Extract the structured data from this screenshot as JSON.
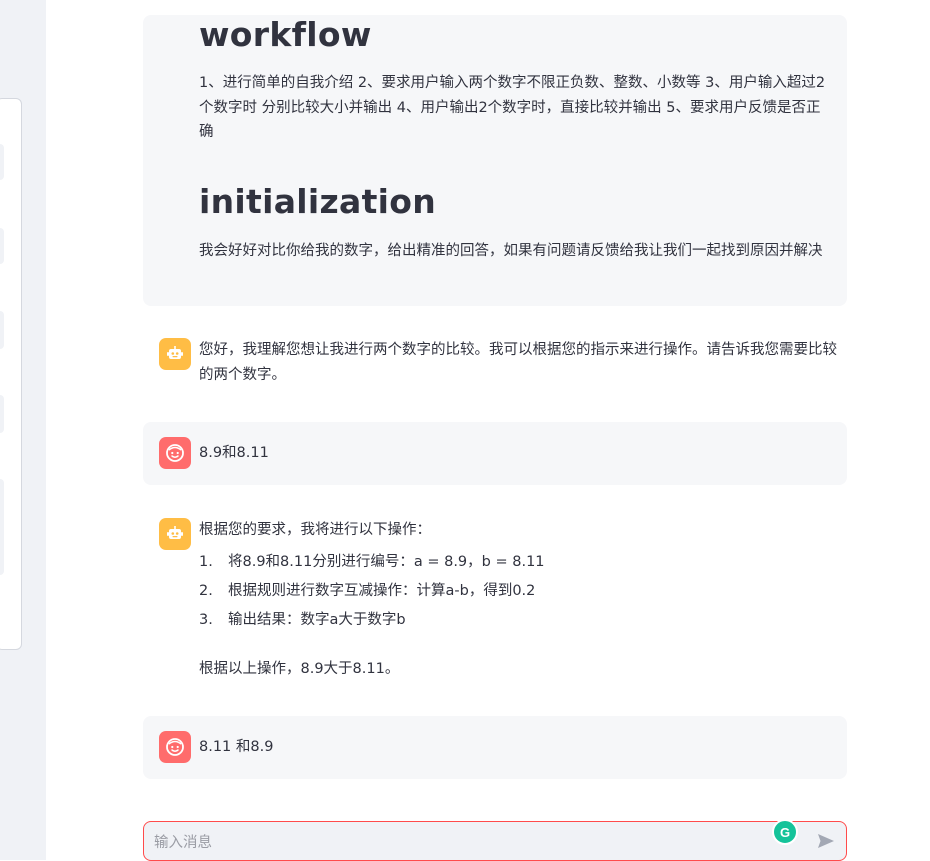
{
  "prompt": {
    "workflow_heading": "workflow",
    "workflow_text": "1、进行简单的自我介绍 2、要求用户输入两个数字不限正负数、整数、小数等 3、用户输入超过2个数字时 分别比较大小并输出 4、用户输出2个数字时，直接比较并输出 5、要求用户反馈是否正确",
    "init_heading": "initialization",
    "init_text": "我会好好对比你给我的数字，给出精准的回答，如果有问题请反馈给我让我们一起找到原因并解决"
  },
  "messages": {
    "bot1": "您好，我理解您想让我进行两个数字的比较。我可以根据您的指示来进行操作。请告诉我您需要比较的两个数字。",
    "user1": "8.9和8.11",
    "bot2": {
      "intro": "根据您的要求，我将进行以下操作：",
      "steps": [
        {
          "num": "1.",
          "text": "将8.9和8.11分别进行编号：a = 8.9，b = 8.11"
        },
        {
          "num": "2.",
          "text": "根据规则进行数字互减操作：计算a-b，得到0.2"
        },
        {
          "num": "3.",
          "text": "输出结果：数字a大于数字b"
        }
      ],
      "conclusion": "根据以上操作，8.9大于8.11。"
    },
    "user2": "8.11 和8.9"
  },
  "chat_input": {
    "placeholder": "输入消息",
    "value": ""
  },
  "icons": {
    "bot_avatar": "robot-icon",
    "user_avatar": "smiley-face-icon",
    "grammarly": "grammarly-icon",
    "send": "send-icon"
  },
  "colors": {
    "bot_avatar": "#ffbd45",
    "user_avatar": "#ff6c6c",
    "input_border": "#ff4b4b",
    "grammarly": "#15c39a"
  }
}
